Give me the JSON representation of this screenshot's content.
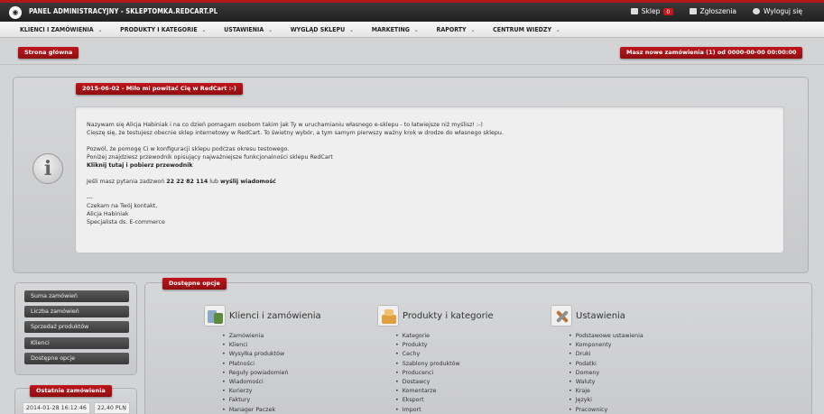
{
  "topbar": {
    "title": "PANEL ADMINISTRACYJNY - SKLEPTOMKA.REDCART.PL",
    "shop_label": "Sklep",
    "shop_badge": "0",
    "tickets_label": "Zgłoszenia",
    "logout_label": "Wyloguj się"
  },
  "menu": [
    "KLIENCI I ZAMÓWIENIA",
    "PRODUKTY I KATEGORIE",
    "USTAWIENIA",
    "WYGLĄD SKLEPU",
    "MARKETING",
    "RAPORTY",
    "CENTRUM WIEDZY"
  ],
  "home_button": "Strona główna",
  "new_orders_button": "Masz nowe zamówienia (1) od 0000-00-00 00:00:00",
  "welcome": {
    "header": "2015-06-02 - Miło mi powitać Cię w RedCart :-)",
    "lines": [
      "Nazywam się Alicja Habiniak i na co dzień pomagam osobom takim jak Ty w uruchamianiu własnego e-sklepu - to łatwiejsze niż myślisz! :-)",
      "Cieszę się, że testujesz obecnie sklep internetowy w RedCart. To świetny wybór, a tym samym pierwszy ważny krok w drodze do własnego sklepu.",
      "Pozwól, że pomogę Ci w konfiguracji sklepu podczas okresu testowego.",
      "Poniżej znajdziesz przewodnik opisujący najważniejsze funkcjonalności sklepu RedCart",
      "Kliknij tutaj i pobierz przewodnik",
      "Jeśli masz pytania zadzwoń",
      "22 22 82 114",
      "lub",
      "wyślij wiadomość",
      "---",
      "Czekam na Twój kontakt,",
      "Alicja Habiniak",
      "Specjalista ds. E-commerce"
    ]
  },
  "sidebar": {
    "items": [
      "Suma zamówień",
      "Liczba zamówień",
      "Sprzedaż produktów",
      "Klienci",
      "Dostępne opcje"
    ]
  },
  "recent": {
    "header": "Ostatnie zamówienia",
    "date": "2014-01-28 16:12:46",
    "amount": "22,40 PLN"
  },
  "options": {
    "header": "Dostępne opcje",
    "columns": [
      {
        "title": "Klienci i zamówienia",
        "icon": "customers-orders-icon",
        "items": [
          "Zamówienia",
          "Klienci",
          "Wysyłka produktów",
          "Płatności",
          "Reguły powiadomień",
          "Wiadomości",
          "Kurierzy",
          "Faktury",
          "Manager Paczek"
        ]
      },
      {
        "title": "Produkty i kategorie",
        "icon": "products-categories-icon",
        "items": [
          "Kategorie",
          "Produkty",
          "Cechy",
          "Szablony produktów",
          "Producenci",
          "Dostawcy",
          "Komentarze",
          "Eksport",
          "Import"
        ]
      },
      {
        "title": "Ustawienia",
        "icon": "settings-tools-icon",
        "items": [
          "Podstawowe ustawienia",
          "Komponenty",
          "Druki",
          "Podatki",
          "Domeny",
          "Waluty",
          "Kraje",
          "Języki",
          "Pracownicy"
        ]
      }
    ]
  }
}
